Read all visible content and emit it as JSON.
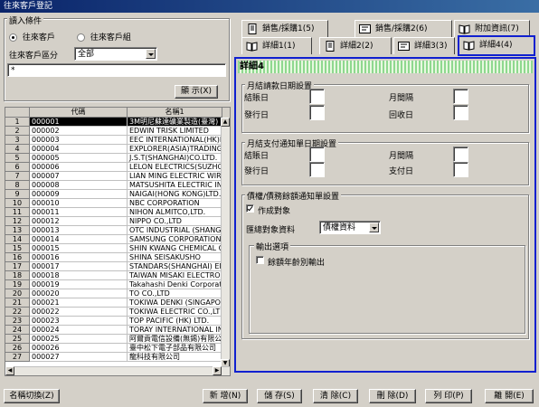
{
  "window": {
    "title": "往來客戶登記"
  },
  "filter": {
    "group_label": "讀入條件",
    "radio_customer": "往來客戶",
    "radio_group": "往來客戶組",
    "category_label": "往來客戶區分",
    "category_value": "全部",
    "code_value": "*",
    "show_button": "顯 示(X)"
  },
  "grid": {
    "col_code": "代碼",
    "col_name": "名稱1",
    "rows": [
      {
        "n": "1",
        "code": "000001",
        "name": "3M明尼蘇達礦業製造(臺灣)",
        "selected": true
      },
      {
        "n": "2",
        "code": "000002",
        "name": "EDWIN TRISK LIMITED"
      },
      {
        "n": "3",
        "code": "000003",
        "name": "EEC INTERNATIONAL(HK)L"
      },
      {
        "n": "4",
        "code": "000004",
        "name": "EXPLORER(ASIA)TRADING"
      },
      {
        "n": "5",
        "code": "000005",
        "name": "J.S.T(SHANGHAI)CO.LTD."
      },
      {
        "n": "6",
        "code": "000006",
        "name": "LELON ELECTRICS(SUZHOU"
      },
      {
        "n": "7",
        "code": "000007",
        "name": "LIAN MING ELECTRIC WIRE"
      },
      {
        "n": "8",
        "code": "000008",
        "name": "MATSUSHITA ELECTRIC IN"
      },
      {
        "n": "9",
        "code": "000009",
        "name": "NAIGAI(HONG KONG)LTD."
      },
      {
        "n": "10",
        "code": "000010",
        "name": "NBC CORPORATION"
      },
      {
        "n": "11",
        "code": "000011",
        "name": "NIHON ALMITCO,LTD."
      },
      {
        "n": "12",
        "code": "000012",
        "name": "NIPPO CO.,LTD"
      },
      {
        "n": "13",
        "code": "000013",
        "name": "OTC INDUSTRIAL (SHANGH"
      },
      {
        "n": "14",
        "code": "000014",
        "name": "SAMSUNG CORPORATION"
      },
      {
        "n": "15",
        "code": "000015",
        "name": "SHIN KWANG CHEMICAL CO"
      },
      {
        "n": "16",
        "code": "000016",
        "name": "SHINA SEISAKUSHO"
      },
      {
        "n": "17",
        "code": "000017",
        "name": "STANDARS(SHANGHAI) ENR"
      },
      {
        "n": "18",
        "code": "000018",
        "name": "TAIWAN MISAKI ELECTRON"
      },
      {
        "n": "19",
        "code": "000019",
        "name": "Takahashi Denki Corporation"
      },
      {
        "n": "20",
        "code": "000020",
        "name": "TO CO.,LTD"
      },
      {
        "n": "21",
        "code": "000021",
        "name": "TOKIWA DENKI (SINGAPOR"
      },
      {
        "n": "22",
        "code": "000022",
        "name": "TOKIWA ELECTRIC CO.,LT"
      },
      {
        "n": "23",
        "code": "000023",
        "name": "TOP PACIFIC (HK) LTD."
      },
      {
        "n": "24",
        "code": "000024",
        "name": "TORAY INTERNATIONAL IN"
      },
      {
        "n": "25",
        "code": "000025",
        "name": "阿爾貢電信設備(無錫)有限公"
      },
      {
        "n": "26",
        "code": "000026",
        "name": "臺中松下電子部品有限公司"
      },
      {
        "n": "27",
        "code": "000027",
        "name": "龍科技有限公司"
      }
    ]
  },
  "tabs": {
    "sales": "銷售/採購1(5)",
    "sales2": "銷售/採購2(6)",
    "attach": "附加資訊(7)",
    "detail1": "詳細1(1)",
    "detail2": "詳細2(2)",
    "detail3": "詳細3(3)",
    "detail4": "詳細4(4)"
  },
  "panel": {
    "title": "詳細4",
    "group1": {
      "label": "月結請款日期設置",
      "close_day": "結賬日",
      "month_interval": "月間隔",
      "issue_day": "發行日",
      "collect_day": "回收日"
    },
    "group2": {
      "label": "月結支付通知單日期設置",
      "close_day": "結賬日",
      "month_interval": "月間隔",
      "issue_day": "發行日",
      "pay_day": "支付日"
    },
    "group3": {
      "label": "債權/債務餘額通知單設置",
      "create_target": "作成對象",
      "create_target_checked": true,
      "summary_label": "匯總對象資料",
      "summary_value": "債權資料",
      "output_label": "輸出選項",
      "opt_year": "餘額年齡別輸出",
      "opt_year_checked": false
    }
  },
  "footer": {
    "name_switch": "名稱切換(Z)",
    "add": "新 增(N)",
    "save": "儲 存(S)",
    "clear": "清 除(C)",
    "delete": "刪 除(D)",
    "print": "列 印(P)",
    "leave": "離 開(E)"
  }
}
